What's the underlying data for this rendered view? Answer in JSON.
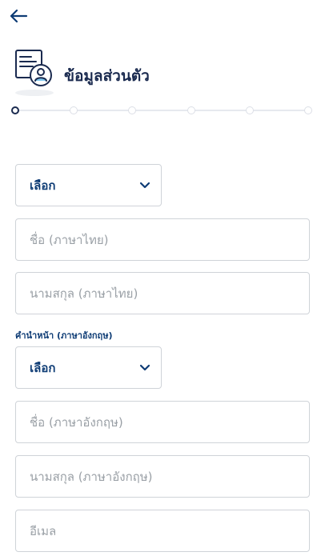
{
  "header": {
    "back_icon": "arrow-left-icon",
    "title": "ข้อมูลส่วนตัว",
    "title_icon": "id-card-user-icon",
    "accent_color": "#0e3c75",
    "title_color": "#1a2a4f"
  },
  "stepper": {
    "total_steps": 6,
    "current_step": 1
  },
  "form": {
    "title_th_select": {
      "value": "เลือก"
    },
    "first_name_th": {
      "placeholder": "ชื่อ (ภาษาไทย)"
    },
    "last_name_th": {
      "placeholder": "นามสกุล (ภาษาไทย)"
    },
    "title_en_label": "คำนำหน้า (ภาษาอังกฤษ)",
    "title_en_select": {
      "value": "เลือก"
    },
    "first_name_en": {
      "placeholder": "ชื่อ (ภาษาอังกฤษ)"
    },
    "last_name_en": {
      "placeholder": "นามสกุล (ภาษาอังกฤษ)"
    },
    "email": {
      "placeholder": "อีเมล"
    }
  }
}
